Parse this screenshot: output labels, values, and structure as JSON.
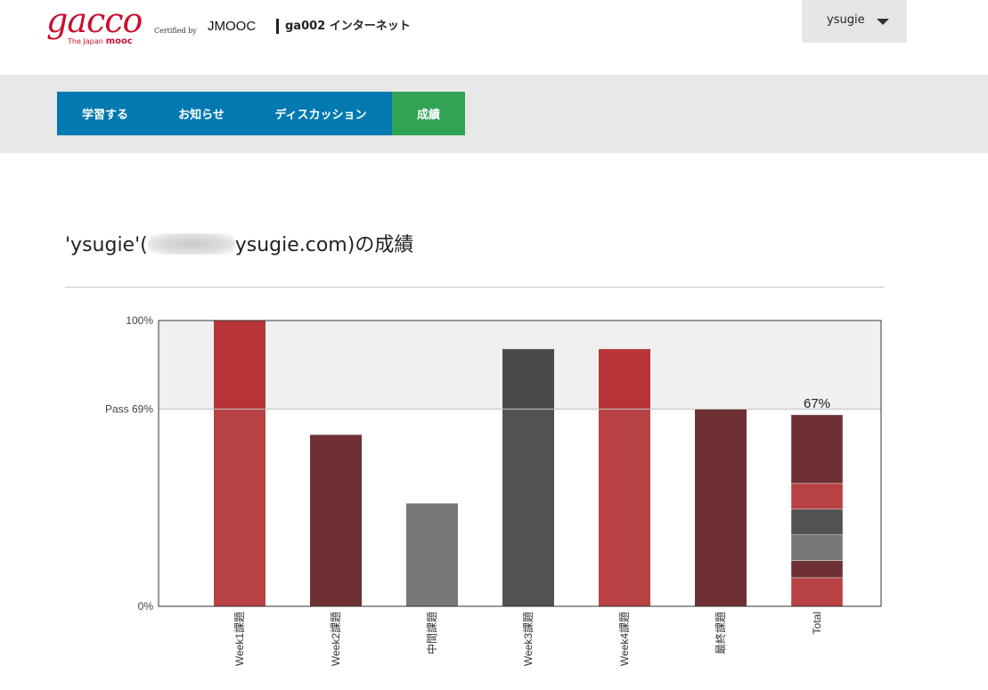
{
  "header": {
    "logo_text": "gacco",
    "logo_sub": "The Japan",
    "logo_sub2": "mooc",
    "certified_by": "Certified by",
    "certifier": "JMOOC",
    "course_title": "ga002 インターネット"
  },
  "user_menu": {
    "username": "ysugie"
  },
  "nav": {
    "items": [
      {
        "label": "学習する",
        "active": false
      },
      {
        "label": "お知らせ",
        "active": false
      },
      {
        "label": "ディスカッション",
        "active": false
      },
      {
        "label": "成績",
        "active": true
      }
    ]
  },
  "progress": {
    "title_prefix": "'ysugie'(",
    "title_suffix": "ysugie.com)の成績"
  },
  "chart_data": {
    "type": "bar",
    "categories": [
      "Week1課題",
      "Week2課題",
      "中間課題",
      "Week3課題",
      "Week4課題",
      "最終課題",
      "Total"
    ],
    "values": [
      100,
      60,
      36,
      90,
      90,
      69,
      67
    ],
    "ylim": [
      0,
      100
    ],
    "pass_line": 69,
    "y_tick_labels": [
      "0%",
      "Pass 69%",
      "100%"
    ],
    "total_label": "67%",
    "total_segments": [
      10,
      6,
      9,
      9,
      9,
      24
    ],
    "total_segment_colors": [
      "#b84144",
      "#6e3032",
      "#777777",
      "#525252",
      "#b84144",
      "#6e3032"
    ],
    "bar_colors": [
      "#b84144",
      "#6e3032",
      "#777777",
      "#525252",
      "#b84144",
      "#6e3032"
    ],
    "pass_band_color": "#f0f0f0",
    "bars_above_pass_colors": [
      "#b73538",
      "#6e3032",
      "#777777",
      "#4a4a4a",
      "#b73538",
      "#6e3032"
    ]
  },
  "colors": {
    "nav_blue": "#0279b0",
    "nav_active_green": "#30a355",
    "brand_red": "#c8102e"
  }
}
